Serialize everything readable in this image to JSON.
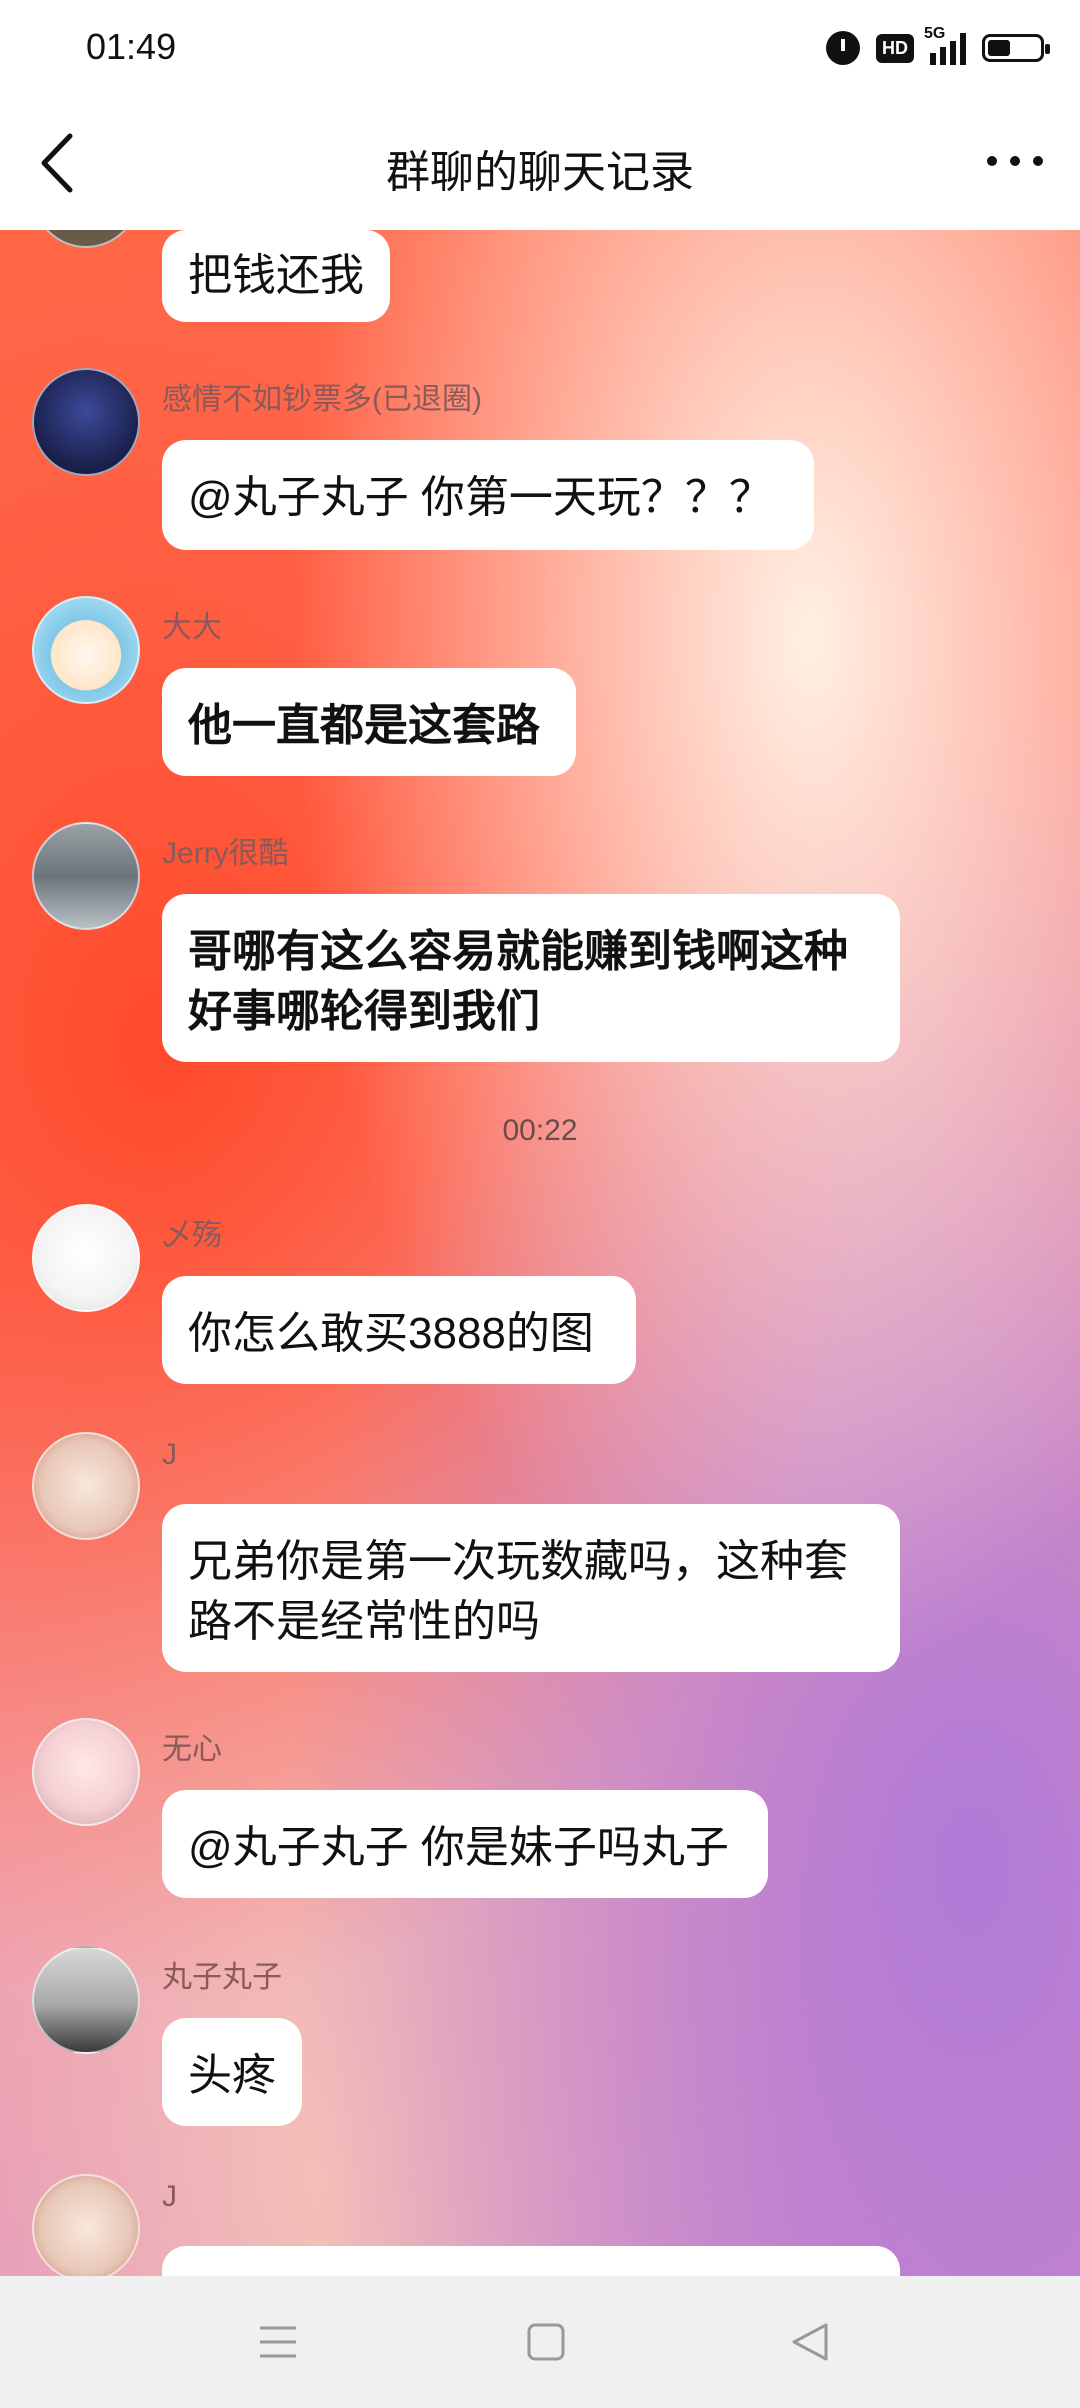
{
  "status_bar": {
    "time": "01:49",
    "network": "5G",
    "hd": "HD"
  },
  "header": {
    "title": "群聊的聊天记录"
  },
  "messages": [
    {
      "text": "把钱还我"
    },
    {
      "sender": "感情不如钞票多(已退圈)",
      "text": "@丸子丸子 你第一天玩？？？"
    },
    {
      "sender": "大大",
      "text": "他一直都是这套路"
    },
    {
      "sender": "Jerry很酷",
      "text": "哥哪有这么容易就能赚到钱啊这种好事哪轮得到我们"
    },
    {
      "sender": "乄殇",
      "text": "你怎么敢买3888的图"
    },
    {
      "sender": "J",
      "text": "兄弟你是第一次玩数藏吗，这种套路不是经常性的吗"
    },
    {
      "sender": "无心",
      "text": "@丸子丸子 你是妹子吗丸子"
    },
    {
      "sender": "丸子丸子",
      "text": "头疼"
    },
    {
      "sender": "J",
      "text": ""
    }
  ],
  "timestamp": "00:22",
  "colors": {
    "bubble": "#ffffff",
    "accent": "#ff5a3c",
    "sender_text": "#8a5a5a"
  },
  "nav": {
    "menu_icon": "menu-icon",
    "home_icon": "home-icon",
    "back_icon": "back-triangle-icon"
  }
}
